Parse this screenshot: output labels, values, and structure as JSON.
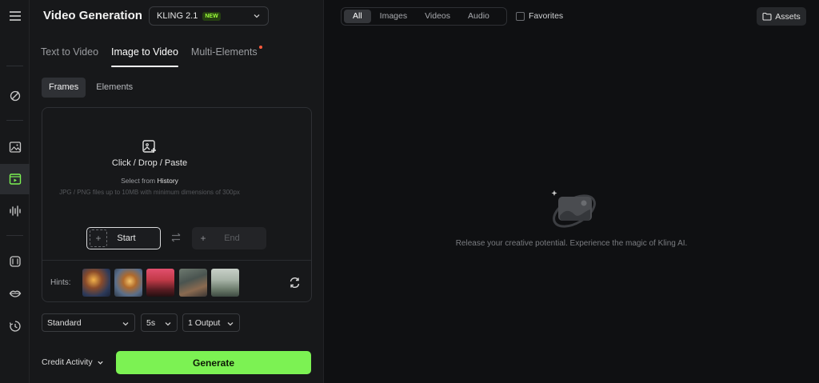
{
  "header": {
    "title": "Video Generation",
    "model": {
      "label": "KLING 2.1",
      "badge": "NEW"
    }
  },
  "tabs": [
    {
      "label": "Text to Video",
      "active": false
    },
    {
      "label": "Image to Video",
      "active": true
    },
    {
      "label": "Multi-Elements",
      "active": false,
      "dot": true
    }
  ],
  "subtabs": [
    {
      "label": "Frames",
      "active": true
    },
    {
      "label": "Elements",
      "active": false
    }
  ],
  "upload": {
    "main": "Click / Drop / Paste",
    "select_prefix": "Select from",
    "select_link": "History",
    "note": "JPG / PNG files up to 10MB with minimum dimensions of 300px",
    "start_label": "Start",
    "end_label": "End"
  },
  "hints": {
    "label": "Hints:"
  },
  "options": {
    "mode": "Standard",
    "duration": "5s",
    "outputs": "1 Output"
  },
  "footer": {
    "credit": "Credit Activity",
    "generate": "Generate"
  },
  "filters": [
    {
      "label": "All",
      "active": true
    },
    {
      "label": "Images",
      "active": false
    },
    {
      "label": "Videos",
      "active": false
    },
    {
      "label": "Audio",
      "active": false
    }
  ],
  "favorites_label": "Favorites",
  "assets_label": "Assets",
  "empty_message": "Release your creative potential. Experience the magic of Kling AI.",
  "colors": {
    "accent": "#7cf253",
    "new_badge": "#9cff3a",
    "dot": "#ff5a3c",
    "panel": "#17181a",
    "canvas": "#0f1012"
  },
  "icons": [
    "menu-icon",
    "sparkle-brush-icon",
    "image-icon",
    "video-icon",
    "audio-wave-icon",
    "effects-icon",
    "lips-icon",
    "history-icon",
    "add-image-icon",
    "swap-icon",
    "refresh-icon",
    "folder-icon",
    "chevron-down-icon",
    "empty-state-icon"
  ]
}
